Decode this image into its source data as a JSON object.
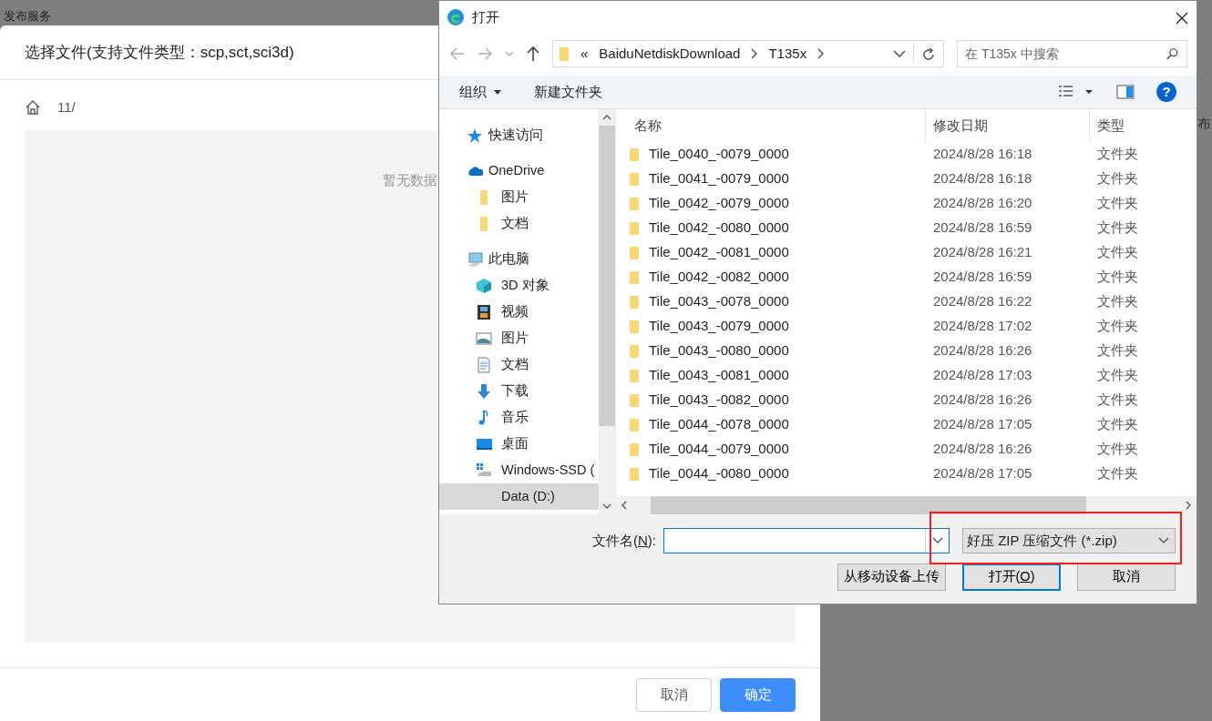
{
  "background": {
    "page_title": "发布服务",
    "edge_text": "布"
  },
  "modal": {
    "title": "选择文件(支持文件类型：scp,sct,sci3d)",
    "breadcrumb": "11/",
    "empty_text": "暂无数据",
    "buttons": [
      {
        "label": "取消",
        "kind": "default"
      },
      {
        "label": "确定",
        "kind": "primary"
      }
    ]
  },
  "open_dialog": {
    "title": "打开",
    "address": {
      "segments": [
        "«",
        "BaiduNetdiskDownload",
        "T135x"
      ]
    },
    "search": {
      "placeholder": "在 T135x 中搜索"
    },
    "toolbar": {
      "organize": "组织",
      "new_folder": "新建文件夹",
      "help": "?"
    },
    "nav": [
      {
        "label": "快速访问",
        "kind": "star",
        "selected": false
      },
      {
        "label": "OneDrive",
        "kind": "cloud",
        "selected": false,
        "children": [
          {
            "label": "图片",
            "kind": "folder",
            "selected": false
          },
          {
            "label": "文档",
            "kind": "folder",
            "selected": false
          }
        ]
      },
      {
        "label": "此电脑",
        "kind": "pc",
        "selected": false,
        "children": [
          {
            "label": "3D 对象",
            "kind": "cube",
            "selected": false
          },
          {
            "label": "视频",
            "kind": "video",
            "selected": false
          },
          {
            "label": "图片",
            "kind": "picture",
            "selected": false
          },
          {
            "label": "文档",
            "kind": "document",
            "selected": false
          },
          {
            "label": "下载",
            "kind": "download",
            "selected": false
          },
          {
            "label": "音乐",
            "kind": "music",
            "selected": false
          },
          {
            "label": "桌面",
            "kind": "desktop",
            "selected": false
          },
          {
            "label": "Windows-SSD (",
            "kind": "drive",
            "selected": false
          },
          {
            "label": "Data (D:)",
            "kind": "none",
            "selected": true
          }
        ]
      }
    ],
    "columns": [
      "名称",
      "修改日期",
      "类型"
    ],
    "rows": [
      {
        "name": "Tile_0040_-0079_0000",
        "date": "2024/8/28 16:18",
        "type": "文件夹"
      },
      {
        "name": "Tile_0041_-0079_0000",
        "date": "2024/8/28 16:18",
        "type": "文件夹"
      },
      {
        "name": "Tile_0042_-0079_0000",
        "date": "2024/8/28 16:20",
        "type": "文件夹"
      },
      {
        "name": "Tile_0042_-0080_0000",
        "date": "2024/8/28 16:59",
        "type": "文件夹"
      },
      {
        "name": "Tile_0042_-0081_0000",
        "date": "2024/8/28 16:21",
        "type": "文件夹"
      },
      {
        "name": "Tile_0042_-0082_0000",
        "date": "2024/8/28 16:59",
        "type": "文件夹"
      },
      {
        "name": "Tile_0043_-0078_0000",
        "date": "2024/8/28 16:22",
        "type": "文件夹"
      },
      {
        "name": "Tile_0043_-0079_0000",
        "date": "2024/8/28 17:02",
        "type": "文件夹"
      },
      {
        "name": "Tile_0043_-0080_0000",
        "date": "2024/8/28 16:26",
        "type": "文件夹"
      },
      {
        "name": "Tile_0043_-0081_0000",
        "date": "2024/8/28 17:03",
        "type": "文件夹"
      },
      {
        "name": "Tile_0043_-0082_0000",
        "date": "2024/8/28 16:26",
        "type": "文件夹"
      },
      {
        "name": "Tile_0044_-0078_0000",
        "date": "2024/8/28 17:05",
        "type": "文件夹"
      },
      {
        "name": "Tile_0044_-0079_0000",
        "date": "2024/8/28 16:26",
        "type": "文件夹"
      },
      {
        "name": "Tile_0044_-0080_0000",
        "date": "2024/8/28 17:05",
        "type": "文件夹"
      }
    ],
    "filename": {
      "label": [
        {
          "text": "文件名(",
          "kind": "plain"
        },
        {
          "text": "N",
          "kind": "access_key"
        },
        {
          "text": "):",
          "kind": "plain"
        }
      ]
    },
    "file_type": {
      "value": "好压 ZIP 压缩文件 (*.zip)",
      "highlighted": true
    },
    "buttons": [
      {
        "label": [
          {
            "text": "从移动设备上传",
            "kind": "plain"
          }
        ],
        "kind": "default"
      },
      {
        "label": [
          {
            "text": "打开(",
            "kind": "plain"
          },
          {
            "text": "O",
            "kind": "access_key"
          },
          {
            "text": ")",
            "kind": "plain"
          }
        ],
        "kind": "default_focus"
      },
      {
        "label": [
          {
            "text": "取消",
            "kind": "plain"
          }
        ],
        "kind": "default"
      }
    ]
  }
}
